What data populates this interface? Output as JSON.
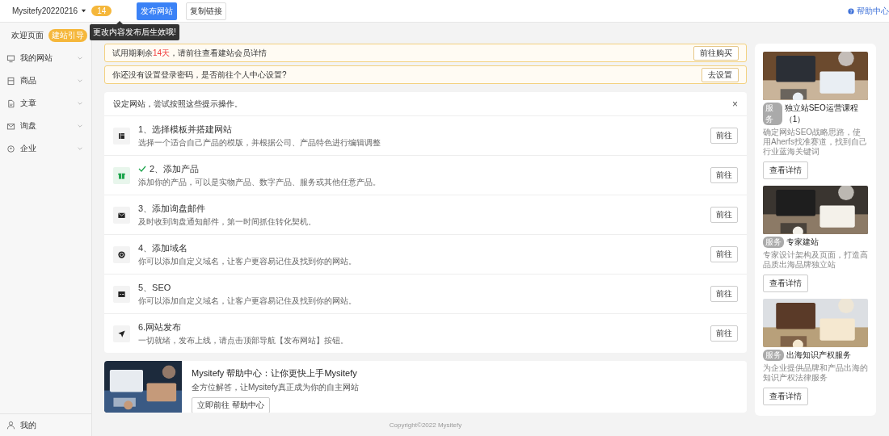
{
  "topbar": {
    "site_name": "Mysitefy20220216",
    "badge": "14",
    "publish_button": "发布网站",
    "copy_button": "复制链接",
    "tooltip": "更改内容发布后生效哦!",
    "help_link": "帮助中心"
  },
  "sidebar": {
    "items": [
      {
        "label": "欢迎页面",
        "kind": "home",
        "badge": "建站引导",
        "expandable": false
      },
      {
        "label": "我的网站",
        "kind": "monitor",
        "expandable": true
      },
      {
        "label": "商品",
        "kind": "box",
        "expandable": true
      },
      {
        "label": "文章",
        "kind": "file",
        "expandable": true
      },
      {
        "label": "询盘",
        "kind": "mail",
        "expandable": true
      },
      {
        "label": "企业",
        "kind": "pin",
        "expandable": true
      }
    ],
    "footer_item": "我的"
  },
  "alerts": [
    {
      "before": "试用期剩余",
      "highlight": "14天",
      "after": "，请前往查看建站会员详情",
      "button": "前往购买"
    },
    {
      "before": "你还没有设置登录密码，是否前往个人中心设置?",
      "button": "去设置"
    }
  ],
  "guide": {
    "title": "设定网站，尝试按照这些提示操作。",
    "close": "×",
    "steps": [
      {
        "kind": "layout",
        "title": "1、选择模板并搭建网站",
        "description": "选择一个适合自己产品的模版，并根据公司、产品特色进行编辑调整",
        "done": false,
        "button": "前往"
      },
      {
        "kind": "gift",
        "title": "2、添加产品",
        "description": "添加你的产品，可以是实物产品、数字产品、服务或其他任意产品。",
        "done": true,
        "button": "前往"
      },
      {
        "kind": "mail",
        "title": "3、添加询盘邮件",
        "description": "及时收到询盘通知邮件，第一时间抓住转化契机。",
        "done": false,
        "button": "前往"
      },
      {
        "kind": "domain",
        "title": "4、添加域名",
        "description": "你可以添加自定义域名，让客户更容易记住及找到你的网站。",
        "done": false,
        "button": "前往"
      },
      {
        "kind": "seo",
        "title": "5、SEO",
        "description": "你可以添加自定义域名，让客户更容易记住及找到你的网站。",
        "done": false,
        "button": "前往"
      },
      {
        "kind": "send",
        "title": "6.网站发布",
        "description": "一切就绪，发布上线，请点击顶部导航【发布网站】按钮。",
        "done": false,
        "button": "前往"
      }
    ]
  },
  "help_banner": {
    "title": "Mysitefy 帮助中心：让你更快上手Mysitefy",
    "subtitle": "全方位解答，让Mysitefy真正成为你的自主网站",
    "button": "立即前往 帮助中心"
  },
  "recommendations": [
    {
      "tag": "服务",
      "title": "独立站SEO运营课程（1）",
      "description": "确定网站SEO战略思路，使用Aherfs找准赛道，找到自己行业蓝海关键词",
      "button": "查看详情"
    },
    {
      "tag": "服务",
      "title": "专家建站",
      "description": "专家设计架构及页面，打造高品质出海品牌独立站",
      "button": "查看详情"
    },
    {
      "tag": "服务",
      "title": "出海知识产权服务",
      "description": "为企业提供品牌和产品出海的知识产权法律服务",
      "button": "查看详情"
    }
  ],
  "footer": "Copyright©2022 Mysitefy"
}
